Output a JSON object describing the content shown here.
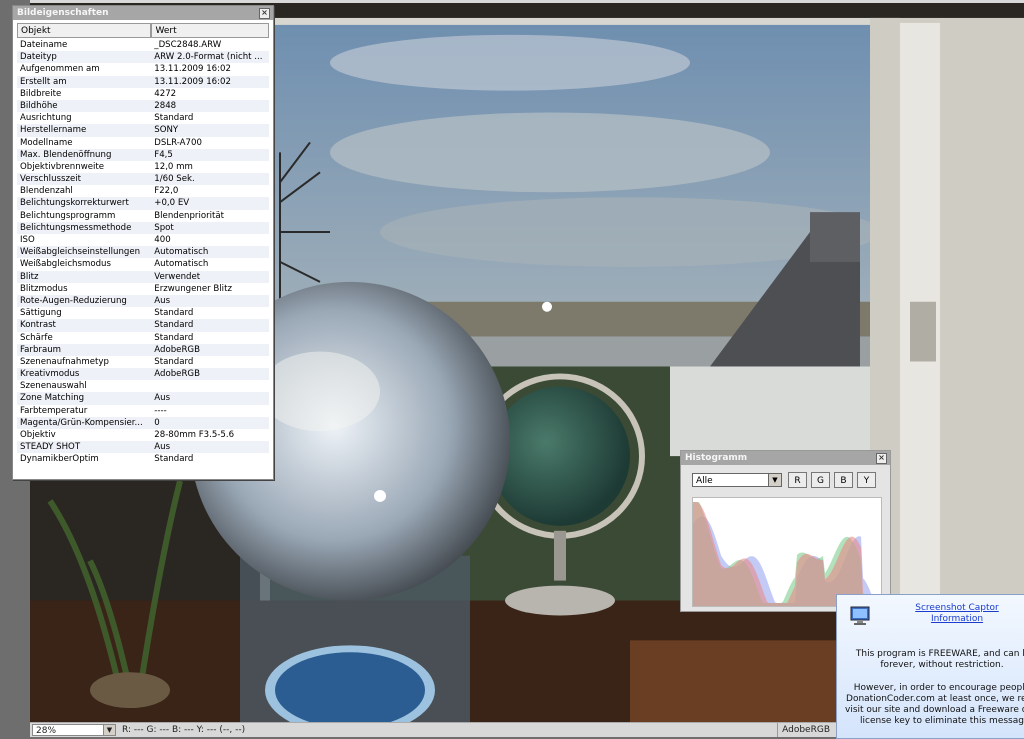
{
  "properties_panel": {
    "title": "Bildeigenschaften",
    "col_object": "Objekt",
    "col_value": "Wert",
    "rows": [
      {
        "k": "Dateiname",
        "v": "_DSC2848.ARW"
      },
      {
        "k": "Dateityp",
        "v": "ARW 2.0-Format (nicht ..."
      },
      {
        "k": "Aufgenommen am",
        "v": "13.11.2009 16:02"
      },
      {
        "k": "Erstellt am",
        "v": "13.11.2009 16:02"
      },
      {
        "k": "Bildbreite",
        "v": "4272"
      },
      {
        "k": "Bildhöhe",
        "v": "2848"
      },
      {
        "k": "Ausrichtung",
        "v": "Standard"
      },
      {
        "k": "Herstellername",
        "v": "SONY"
      },
      {
        "k": "Modellname",
        "v": "DSLR-A700"
      },
      {
        "k": "Max. Blendenöffnung",
        "v": "F4,5"
      },
      {
        "k": "Objektivbrennweite",
        "v": "12,0 mm"
      },
      {
        "k": "Verschlusszeit",
        "v": "1/60 Sek."
      },
      {
        "k": "Blendenzahl",
        "v": "F22,0"
      },
      {
        "k": "Belichtungskorrekturwert",
        "v": "+0,0 EV"
      },
      {
        "k": "Belichtungsprogramm",
        "v": "Blendenpriorität"
      },
      {
        "k": "Belichtungsmessmethode",
        "v": "Spot"
      },
      {
        "k": "ISO",
        "v": "400"
      },
      {
        "k": "Weißabgleichseinstellungen",
        "v": "Automatisch"
      },
      {
        "k": "Weißabgleichsmodus",
        "v": "Automatisch"
      },
      {
        "k": "Blitz",
        "v": "Verwendet"
      },
      {
        "k": "Blitzmodus",
        "v": "Erzwungener Blitz"
      },
      {
        "k": "Rote-Augen-Reduzierung",
        "v": "Aus"
      },
      {
        "k": "Sättigung",
        "v": "Standard"
      },
      {
        "k": "Kontrast",
        "v": "Standard"
      },
      {
        "k": "Schärfe",
        "v": "Standard"
      },
      {
        "k": "Farbraum",
        "v": "AdobeRGB"
      },
      {
        "k": "Szenenaufnahmetyp",
        "v": "Standard"
      },
      {
        "k": "Kreativmodus",
        "v": "AdobeRGB"
      },
      {
        "k": "Szenenauswahl",
        "v": ""
      },
      {
        "k": "Zone Matching",
        "v": "Aus"
      },
      {
        "k": "Farbtemperatur",
        "v": "----"
      },
      {
        "k": "Magenta/Grün-Kompensier...",
        "v": "0"
      },
      {
        "k": "Objektiv",
        "v": "28-80mm F3.5-5.6"
      },
      {
        "k": "STEADY SHOT",
        "v": "Aus"
      },
      {
        "k": "DynamikberOptim",
        "v": "Standard"
      }
    ]
  },
  "histogram": {
    "title": "Histogramm",
    "channel_select": "Alle",
    "buttons": [
      "R",
      "G",
      "B",
      "Y"
    ]
  },
  "statusbar": {
    "zoom": "28%",
    "pixel_readout": "R: ---   G: ---   B: ---   Y: ---     (--, --)",
    "color_space": "AdobeRGB"
  },
  "info_popup": {
    "link": "Screenshot Captor Information",
    "para1": "This program is FREEWARE, and can b forever, without restriction.",
    "para2": "However, in order to encourage people DonationCoder.com at least once, we requ visit our site and download a Freeware or F license key to eliminate this messag"
  },
  "colors": {
    "titlebar": "#a6a6a6",
    "row_alt": "#eef1f7",
    "hist_red": "#e88a8a",
    "hist_green": "#7fcf8f",
    "hist_blue": "#9aa6ee",
    "link": "#1a3ccf"
  }
}
